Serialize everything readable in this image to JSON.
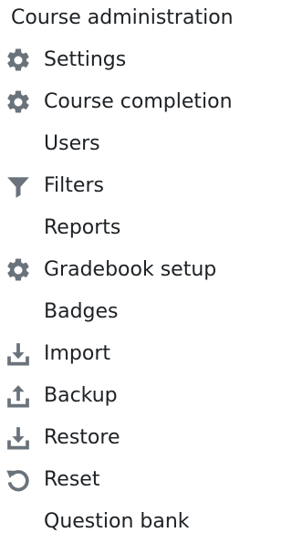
{
  "title": "Course administration",
  "icon_color": "#6a737b",
  "items": [
    {
      "label": "Settings",
      "icon": "gear-icon"
    },
    {
      "label": "Course completion",
      "icon": "gear-icon"
    },
    {
      "label": "Users",
      "icon": ""
    },
    {
      "label": "Filters",
      "icon": "filter-icon"
    },
    {
      "label": "Reports",
      "icon": ""
    },
    {
      "label": "Gradebook setup",
      "icon": "gear-icon"
    },
    {
      "label": "Badges",
      "icon": ""
    },
    {
      "label": "Import",
      "icon": "download-tray-icon"
    },
    {
      "label": "Backup",
      "icon": "upload-tray-icon"
    },
    {
      "label": "Restore",
      "icon": "download-tray-icon"
    },
    {
      "label": "Reset",
      "icon": "reset-icon"
    },
    {
      "label": "Question bank",
      "icon": ""
    }
  ]
}
